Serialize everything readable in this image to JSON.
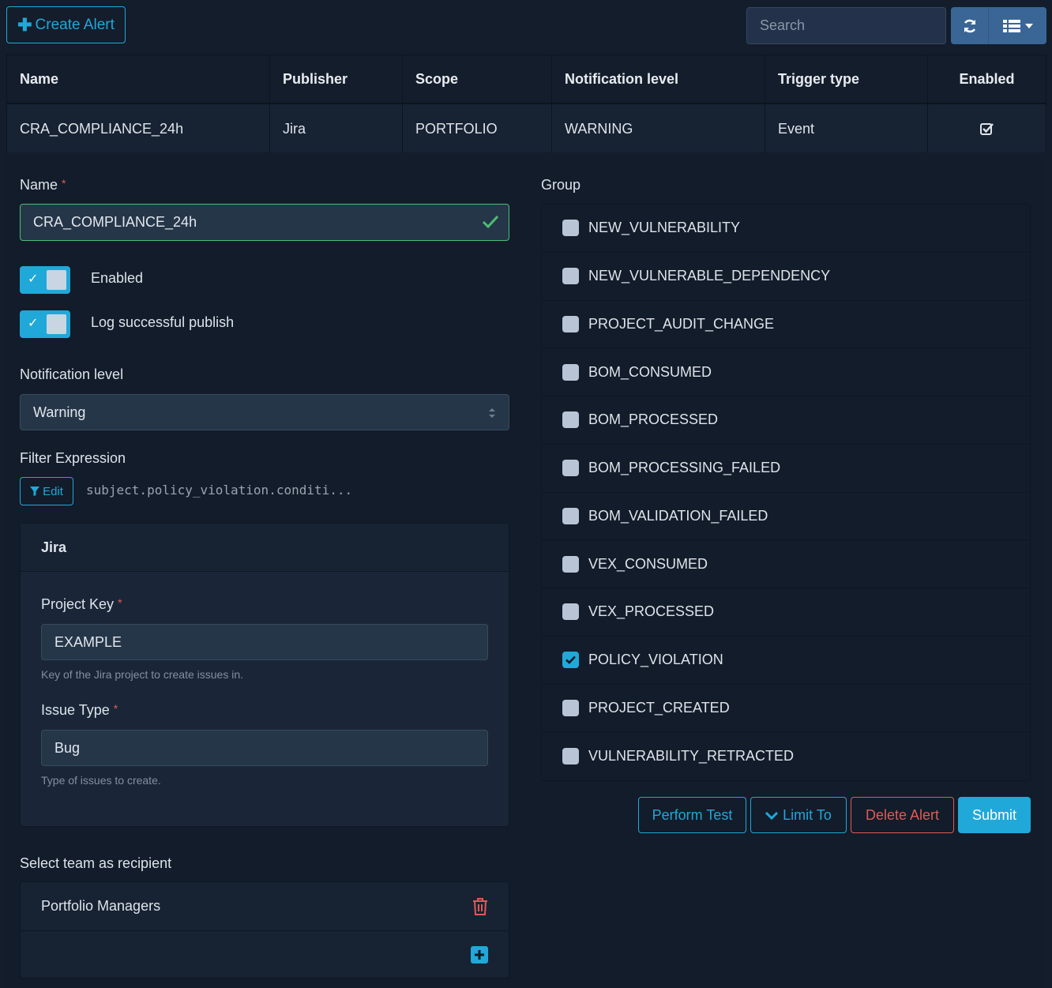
{
  "toolbar": {
    "create_label": "Create Alert",
    "search_placeholder": "Search"
  },
  "table": {
    "headers": [
      "Name",
      "Publisher",
      "Scope",
      "Notification level",
      "Trigger type",
      "Enabled"
    ],
    "rows": [
      {
        "name": "CRA_COMPLIANCE_24h",
        "publisher": "Jira",
        "scope": "PORTFOLIO",
        "level": "WARNING",
        "trigger": "Event",
        "enabled": true
      }
    ]
  },
  "form": {
    "name_label": "Name",
    "name_value": "CRA_COMPLIANCE_24h",
    "enabled_label": "Enabled",
    "log_label": "Log successful publish",
    "notification_level_label": "Notification level",
    "notification_level_value": "Warning",
    "filter_label": "Filter Expression",
    "filter_edit": "Edit",
    "filter_value": "subject.policy_violation.conditi...",
    "publisher_title": "Jira",
    "project_key_label": "Project Key",
    "project_key_value": "EXAMPLE",
    "project_key_help": "Key of the Jira project to create issues in.",
    "issue_type_label": "Issue Type",
    "issue_type_value": "Bug",
    "issue_type_help": "Type of issues to create.",
    "team_label": "Select team as recipient",
    "teams": [
      "Portfolio Managers"
    ]
  },
  "group": {
    "label": "Group",
    "items": [
      {
        "label": "NEW_VULNERABILITY",
        "checked": false
      },
      {
        "label": "NEW_VULNERABLE_DEPENDENCY",
        "checked": false
      },
      {
        "label": "PROJECT_AUDIT_CHANGE",
        "checked": false
      },
      {
        "label": "BOM_CONSUMED",
        "checked": false
      },
      {
        "label": "BOM_PROCESSED",
        "checked": false
      },
      {
        "label": "BOM_PROCESSING_FAILED",
        "checked": false
      },
      {
        "label": "BOM_VALIDATION_FAILED",
        "checked": false
      },
      {
        "label": "VEX_CONSUMED",
        "checked": false
      },
      {
        "label": "VEX_PROCESSED",
        "checked": false
      },
      {
        "label": "POLICY_VIOLATION",
        "checked": true
      },
      {
        "label": "PROJECT_CREATED",
        "checked": false
      },
      {
        "label": "VULNERABILITY_RETRACTED",
        "checked": false
      }
    ]
  },
  "actions": {
    "test": "Perform Test",
    "limit": "Limit To",
    "delete": "Delete Alert",
    "submit": "Submit"
  },
  "colors": {
    "accent": "#20a8d8",
    "danger": "#e05a55",
    "success": "#4dbd74"
  }
}
